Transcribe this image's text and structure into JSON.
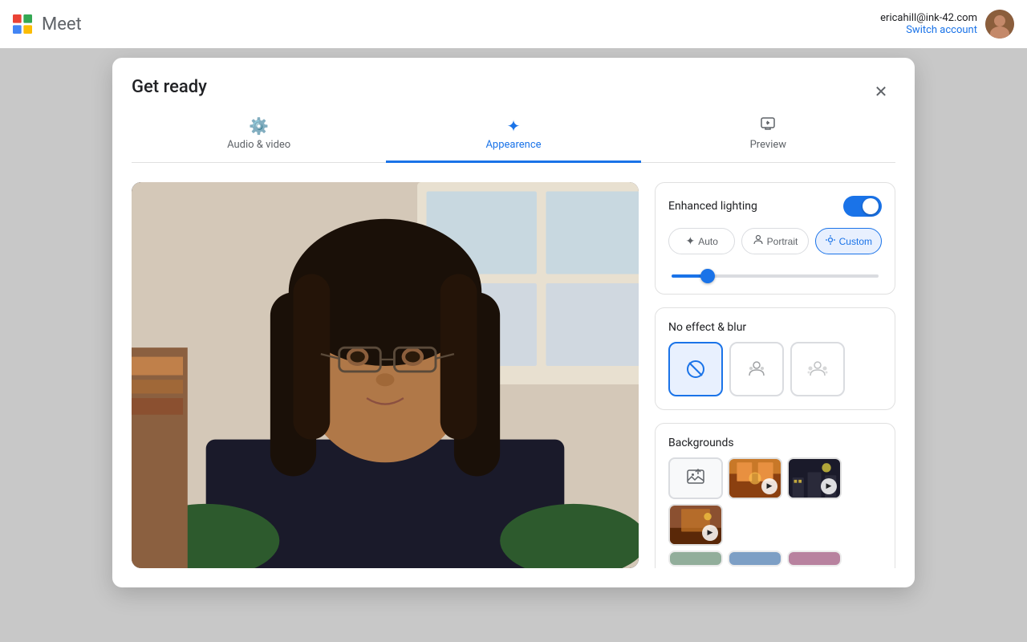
{
  "app": {
    "name": "Meet",
    "logo_alt": "Google Meet logo"
  },
  "topbar": {
    "email": "ericahill@ink-42.com",
    "switch_account_label": "Switch account"
  },
  "dialog": {
    "title": "Get ready",
    "close_label": "✕",
    "tabs": [
      {
        "id": "audio-video",
        "label": "Audio & video",
        "icon": "⚙",
        "active": false
      },
      {
        "id": "appearance",
        "label": "Appearence",
        "icon": "✦",
        "active": true
      },
      {
        "id": "preview",
        "label": "Preview",
        "icon": "📋",
        "active": false
      }
    ]
  },
  "enhanced_lighting": {
    "label": "Enhanced lighting",
    "enabled": true,
    "modes": [
      {
        "id": "auto",
        "label": "Auto",
        "icon": "✦",
        "active": false
      },
      {
        "id": "portrait",
        "label": "Portrait",
        "icon": "👤",
        "active": false
      },
      {
        "id": "custom",
        "label": "Custom",
        "icon": "🔆",
        "active": true
      }
    ],
    "slider_value": 15
  },
  "effects": {
    "section_label": "No effect & blur",
    "items": [
      {
        "id": "no-effect",
        "label": "No effect",
        "icon": "⊘",
        "active": true
      },
      {
        "id": "blur-slight",
        "label": "Slight blur",
        "icon": "👤",
        "active": false
      },
      {
        "id": "blur-strong",
        "label": "Strong blur",
        "icon": "👥",
        "active": false
      }
    ]
  },
  "backgrounds": {
    "section_label": "Backgrounds",
    "items": [
      {
        "id": "upload",
        "label": "Upload background",
        "type": "upload",
        "icon": "🖼"
      },
      {
        "id": "bg1",
        "label": "Background 1",
        "type": "image",
        "color": "warm"
      },
      {
        "id": "bg2",
        "label": "Background 2",
        "type": "image",
        "color": "dark"
      },
      {
        "id": "bg3",
        "label": "Background 3",
        "type": "image",
        "color": "brown"
      }
    ]
  },
  "icons": {
    "close": "✕",
    "gear": "⚙",
    "sparkle": "✦",
    "clipboard": "📋",
    "no_effect": "⊘",
    "person": "👤",
    "person_blurred": "👥",
    "upload_image": "🖼",
    "play": "▶",
    "sun": "☀"
  }
}
